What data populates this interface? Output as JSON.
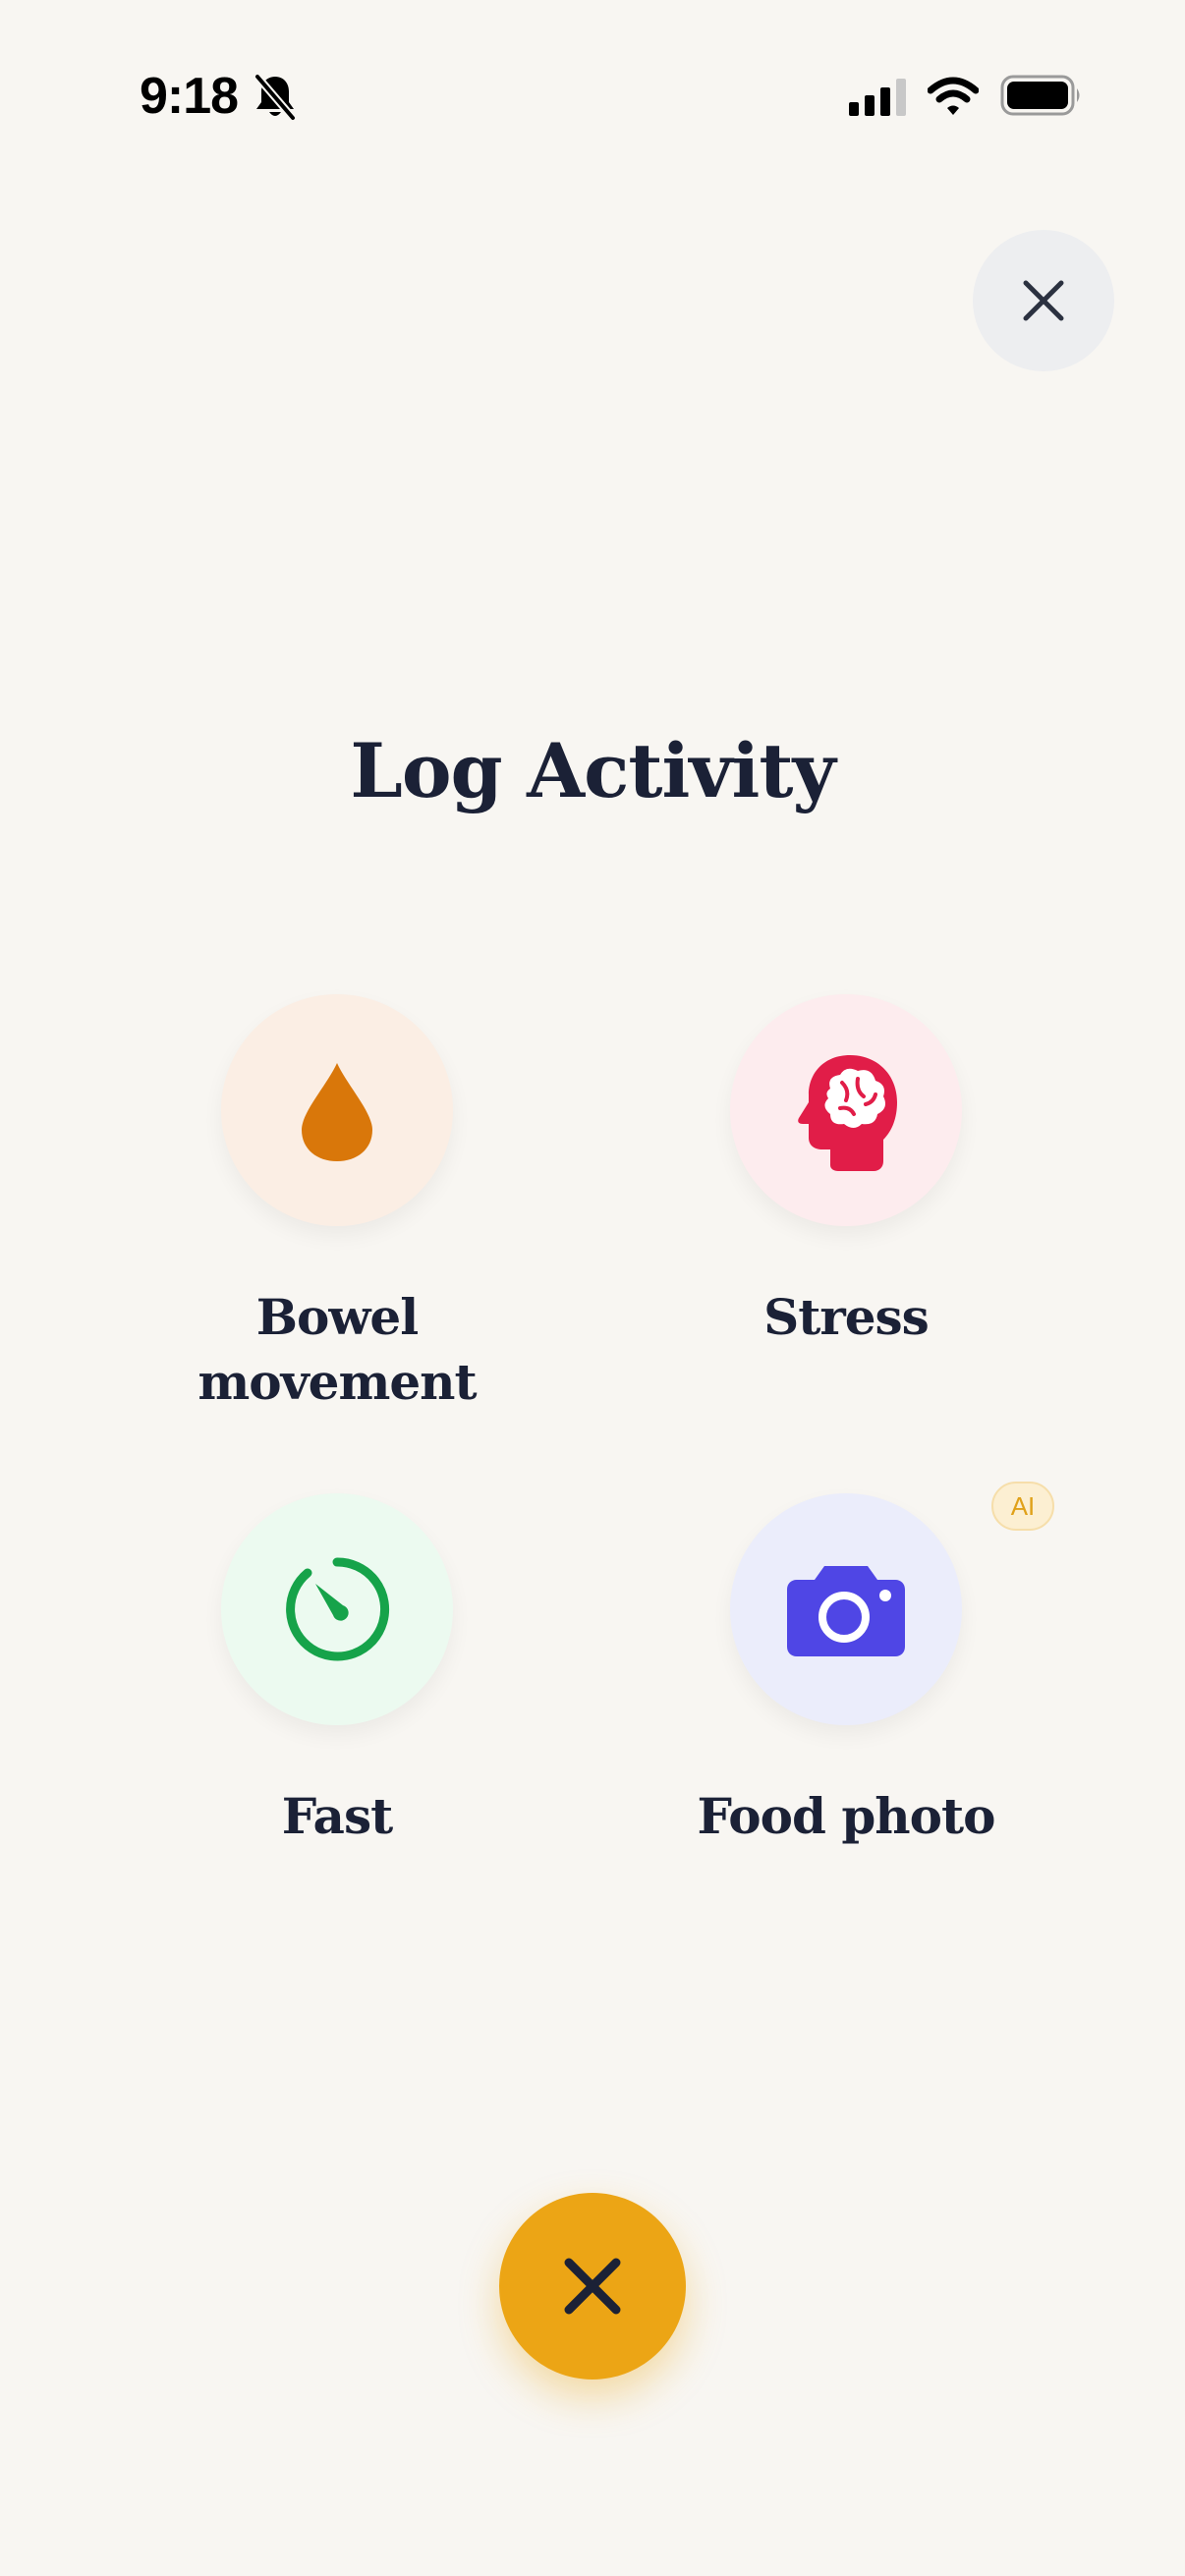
{
  "status_bar": {
    "time": "9:18",
    "icons": [
      "bell-slash-icon",
      "cellular-signal-icon",
      "wifi-icon",
      "battery-icon"
    ]
  },
  "header": {
    "close_icon": "close-icon"
  },
  "title": "Log Activity",
  "options": [
    {
      "label": "Bowel movement",
      "icon": "droplet-icon",
      "icon_color": "#d9770a",
      "bg_color": "#fbeee4"
    },
    {
      "label": "Stress",
      "icon": "brain-head-icon",
      "icon_color": "#e11d48",
      "bg_color": "#fdecee"
    },
    {
      "label": "Fast",
      "icon": "timer-icon",
      "icon_color": "#16a34a",
      "bg_color": "#ecfaf0"
    },
    {
      "label": "Food photo",
      "icon": "camera-icon",
      "icon_color": "#4f46e5",
      "bg_color": "#ebedfb",
      "badge": "AI"
    }
  ],
  "fab": {
    "icon": "close-icon",
    "color": "#eca515"
  }
}
